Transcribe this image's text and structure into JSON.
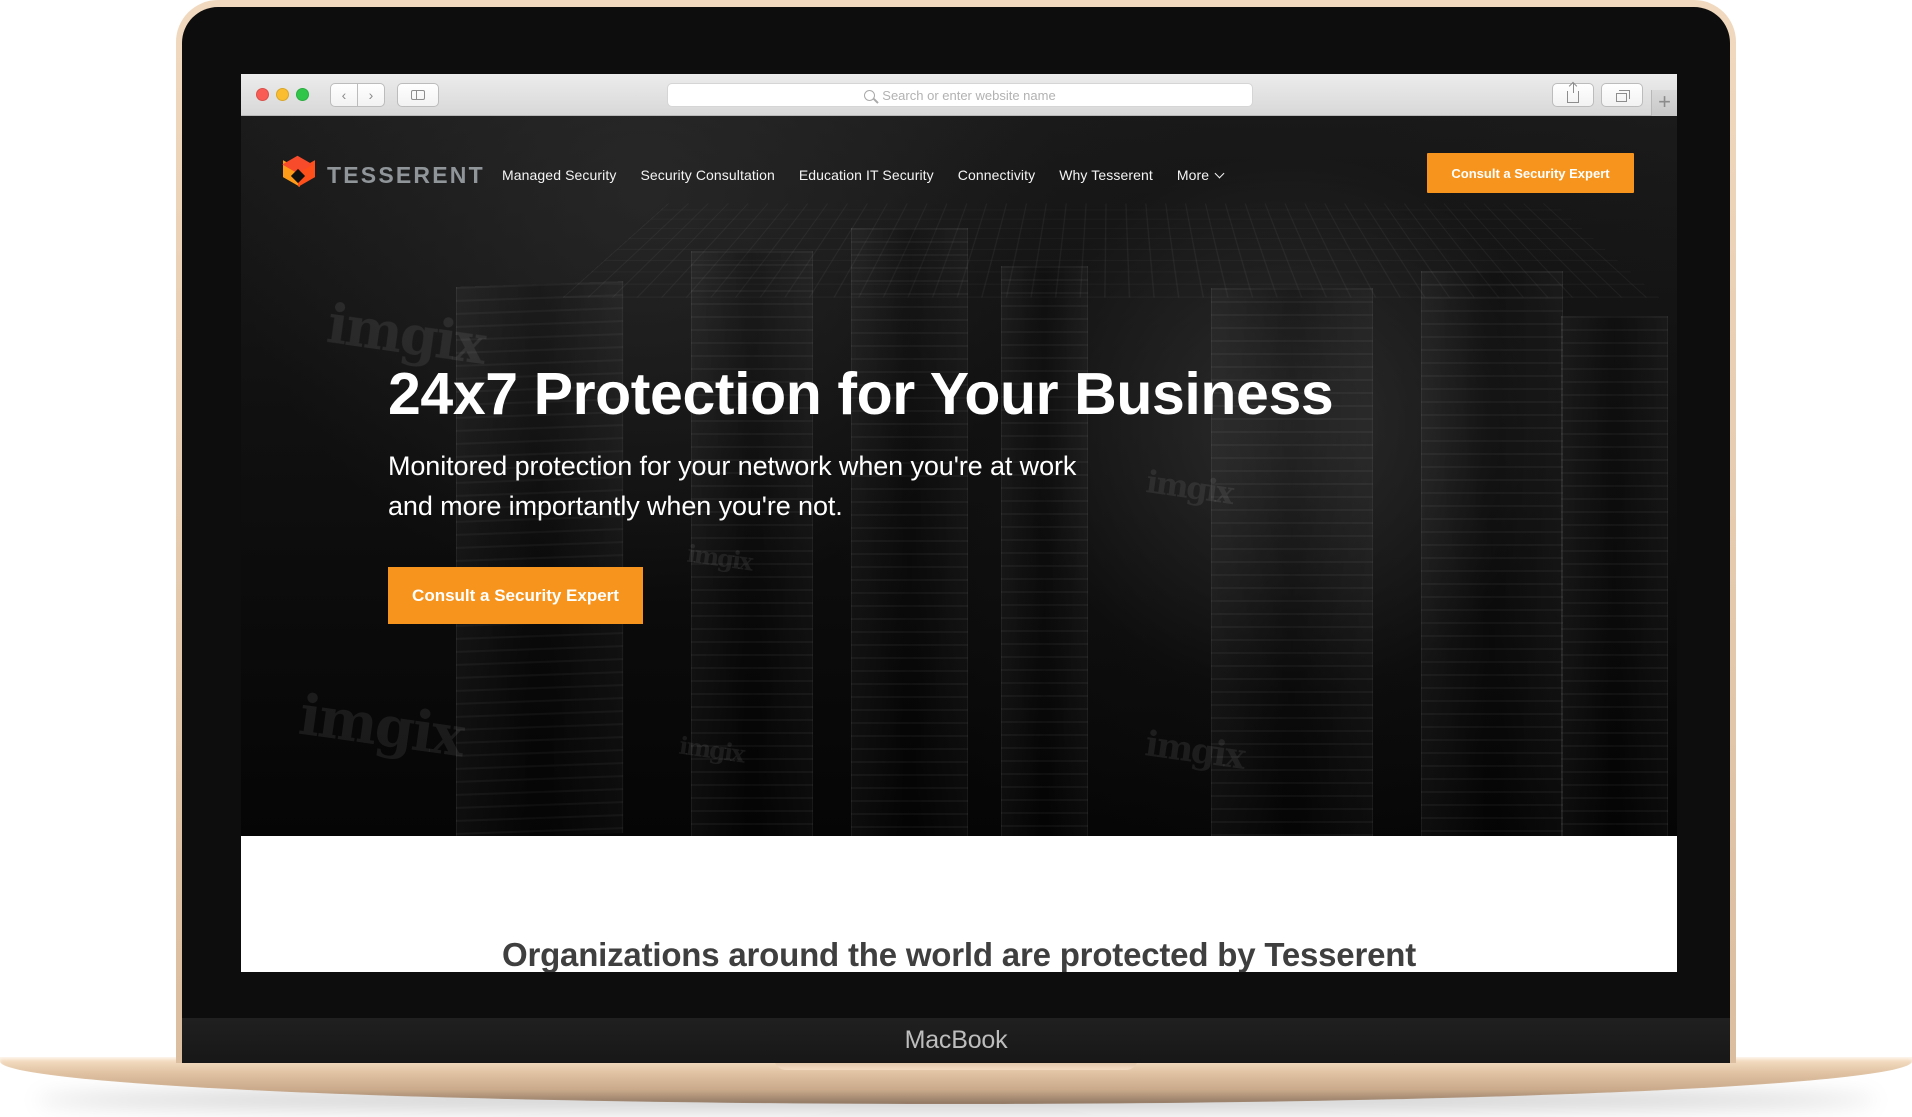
{
  "device": {
    "label": "MacBook"
  },
  "browser": {
    "address_placeholder": "Search or enter website name",
    "icons": {
      "back": "chevron-left-icon",
      "forward": "chevron-right-icon",
      "sidebar": "sidebar-icon",
      "share": "share-icon",
      "tabs": "tabs-icon",
      "new_tab": "plus-icon",
      "search": "search-icon"
    }
  },
  "site": {
    "brand": "TESSERENT",
    "nav": [
      {
        "label": "Managed Security"
      },
      {
        "label": "Security Consultation"
      },
      {
        "label": "Education IT Security"
      },
      {
        "label": "Connectivity"
      },
      {
        "label": "Why Tesserent"
      },
      {
        "label": "More"
      }
    ],
    "header_cta": "Consult a Security Expert",
    "hero": {
      "title": "24x7 Protection for Your Business",
      "subtitle": "Monitored protection for your network when you're at work and more importantly when you're not.",
      "cta": "Consult a Security Expert",
      "watermark": "imgix"
    },
    "section": {
      "title": "Organizations around the world are protected by Tesserent"
    },
    "colors": {
      "accent": "#f7941d",
      "brand_orange": "#ff4f1a",
      "hero_background": "#050505",
      "section_text": "#3f3f3f"
    }
  }
}
